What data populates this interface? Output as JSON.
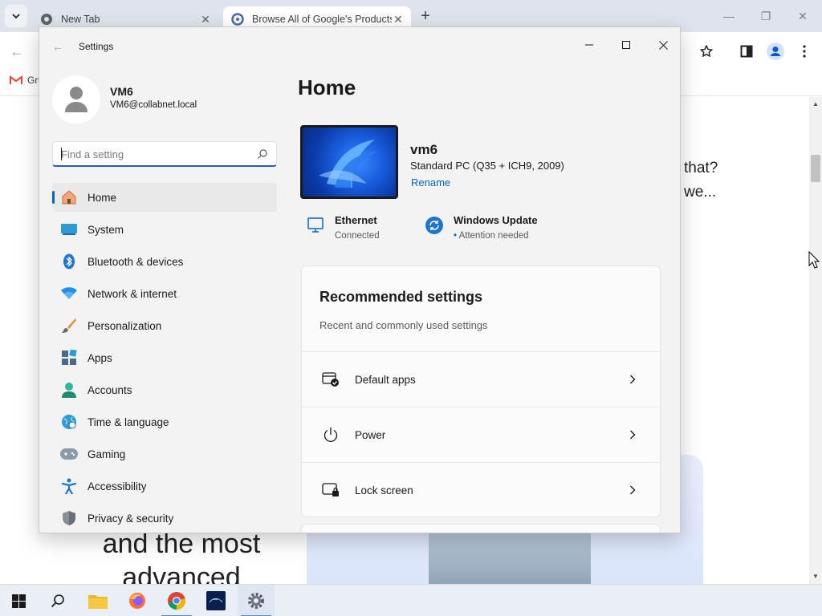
{
  "browser": {
    "tabs": [
      {
        "title": "New Tab"
      },
      {
        "title": "Browse All of Google's Products"
      }
    ],
    "bookmark_gmail": "Gm"
  },
  "web": {
    "right_text": [
      "that?",
      "we..."
    ],
    "big_text": "and the most advanced"
  },
  "settings": {
    "window_title": "Settings",
    "profile": {
      "name": "VM6",
      "email": "VM6@collabnet.local"
    },
    "search": {
      "placeholder": "Find a setting",
      "value": ""
    },
    "nav": [
      {
        "label": "Home",
        "icon": "home-icon"
      },
      {
        "label": "System",
        "icon": "system-icon"
      },
      {
        "label": "Bluetooth & devices",
        "icon": "bluetooth-icon"
      },
      {
        "label": "Network & internet",
        "icon": "network-icon"
      },
      {
        "label": "Personalization",
        "icon": "brush-icon"
      },
      {
        "label": "Apps",
        "icon": "apps-icon"
      },
      {
        "label": "Accounts",
        "icon": "accounts-icon"
      },
      {
        "label": "Time & language",
        "icon": "globe-icon"
      },
      {
        "label": "Gaming",
        "icon": "gamepad-icon"
      },
      {
        "label": "Accessibility",
        "icon": "accessibility-icon"
      },
      {
        "label": "Privacy & security",
        "icon": "shield-icon"
      }
    ],
    "main": {
      "title": "Home",
      "device": {
        "name": "vm6",
        "description": "Standard PC (Q35 + ICH9, 2009)",
        "rename": "Rename"
      },
      "status": [
        {
          "title": "Ethernet",
          "sub": "Connected"
        },
        {
          "title": "Windows Update",
          "sub": "Attention needed"
        }
      ],
      "recommended": {
        "title": "Recommended settings",
        "subtitle": "Recent and commonly used settings",
        "items": [
          {
            "label": "Default apps"
          },
          {
            "label": "Power"
          },
          {
            "label": "Lock screen"
          }
        ]
      }
    }
  },
  "colors": {
    "accent": "#0067c0",
    "update_dot": "#0067c0"
  }
}
